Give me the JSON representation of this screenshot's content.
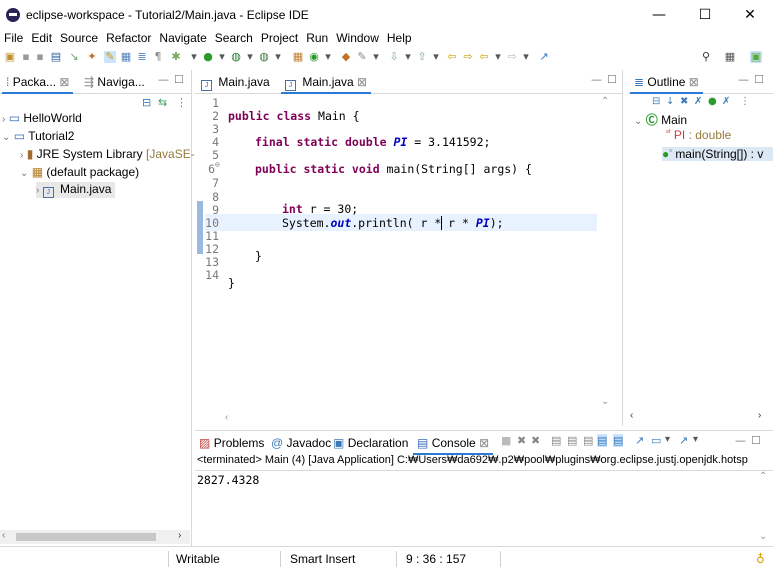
{
  "window": {
    "title": "eclipse-workspace - Tutorial2/Main.java - Eclipse IDE",
    "minimize": "—",
    "maximize": "☐",
    "close": "✕"
  },
  "menu": [
    "File",
    "Edit",
    "Source",
    "Refactor",
    "Navigate",
    "Search",
    "Project",
    "Run",
    "Window",
    "Help"
  ],
  "left_panel": {
    "tabs": [
      {
        "label": "Packa...",
        "close": "⊠"
      },
      {
        "label": "Naviga...",
        "close": ""
      }
    ],
    "tree": [
      {
        "label": "HelloWorld"
      },
      {
        "label": "Tutorial2"
      },
      {
        "label": "JRE System Library",
        "suffix": "[JavaSE-"
      },
      {
        "label": "(default package)"
      },
      {
        "label": "Main.java"
      }
    ]
  },
  "editor": {
    "tabs": [
      {
        "label": "Main.java"
      },
      {
        "label": "Main.java",
        "close": "⊠"
      }
    ],
    "line_numbers": [
      "1",
      "2",
      "3",
      "4",
      "5",
      "6",
      "7",
      "8",
      "9",
      "10",
      "11",
      "12",
      "13",
      "14"
    ],
    "line6_marker": "⊖",
    "code": {
      "l2_kw": "public class",
      "l2_rest": " Main {",
      "l4_kw": "final static double",
      "l4_const": "PI",
      "l4_rest": " = 3.141592;",
      "l6_kw": "public static void",
      "l6_rest": " main(String[] args) {",
      "l8_kw": "int",
      "l8_rest": " r = 30;",
      "l9_a": "System.",
      "l9_out": "out",
      "l9_b": ".println( r * r * ",
      "l9_pi": "PI",
      "l9_c": ");",
      "l11": "}",
      "l13": "}"
    }
  },
  "outline": {
    "tab": "Outline",
    "close": "⊠",
    "class_name": "Main",
    "field": "PI",
    "field_type": " : double",
    "method": "main(String[]) : v"
  },
  "console": {
    "tabs": [
      {
        "label": "Problems"
      },
      {
        "label": "Javadoc"
      },
      {
        "label": "Declaration"
      },
      {
        "label": "Console",
        "close": "⊠"
      }
    ],
    "terminated": "<terminated> Main (4) [Java Application] C:₩Users₩da692₩.p2₩pool₩plugins₩org.eclipse.justj.openjdk.hotsp",
    "output": "2827.4328"
  },
  "status": {
    "writable": "Writable",
    "insert": "Smart Insert",
    "position": "9 : 36 : 157"
  },
  "colors": {
    "accent": "#2a7bd8",
    "keyword": "#7f0055",
    "constant": "#0000c0",
    "selection_line": "#e8f2fe"
  }
}
